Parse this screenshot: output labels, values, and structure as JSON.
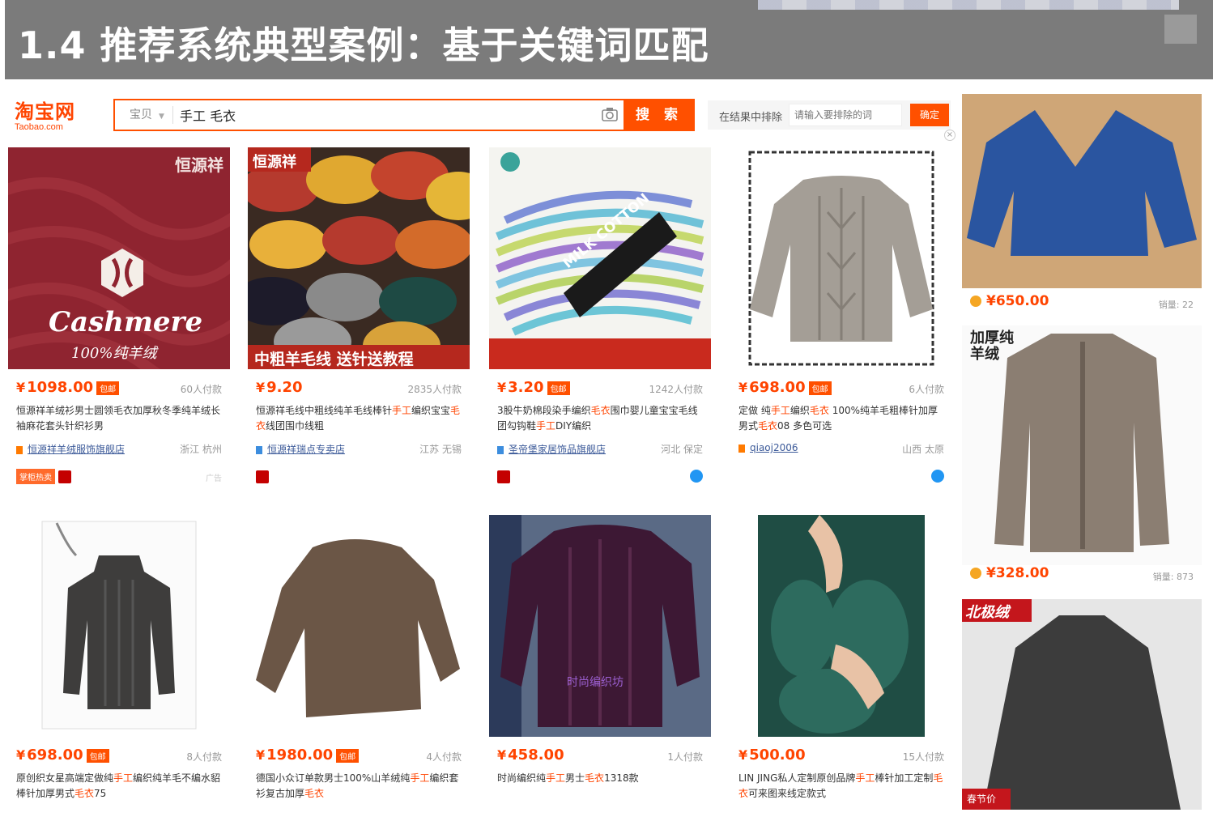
{
  "slide": {
    "title": "1.4 推荐系统典型案例：基于关键词匹配"
  },
  "header": {
    "logo_cn": "淘宝网",
    "logo_en": "Taobao.com",
    "scope": "宝贝",
    "query": "手工 毛衣",
    "search_button": "搜 索",
    "exclude_label": "在结果中排除",
    "exclude_placeholder": "请输入要排除的词",
    "exclude_button": "确定"
  },
  "colors": {
    "accent": "#ff5000",
    "price": "#ff4400",
    "shop_link": "#3c5a99"
  },
  "products": [
    {
      "price": "1098.00",
      "badge": "包邮",
      "sold": "60人付款",
      "desc_parts": [
        "恒源祥羊绒衫男士圆领毛衣加厚秋冬季纯羊绒长袖麻花套头针织衫男"
      ],
      "shop": "恒源祥羊绒服饰旗舰店",
      "location": "浙江 杭州",
      "img_brand": "恒源祥",
      "img_text": "Cashmere",
      "img_sub": "100%纯羊绒",
      "tag": "掌柜热卖",
      "ad": "广告"
    },
    {
      "price": "9.20",
      "badge": "",
      "sold": "2835人付款",
      "desc_parts": [
        "恒源祥毛线中粗线纯羊毛线棒针",
        "手工",
        "编织宝宝",
        "毛衣",
        "线团围巾线粗"
      ],
      "shop": "恒源祥瑞点专卖店",
      "location": "江苏 无锡",
      "img_brand": "恒源祥",
      "img_text": "中粗羊毛线 送针送教程"
    },
    {
      "price": "3.20",
      "badge": "包邮",
      "sold": "1242人付款",
      "desc_parts": [
        "3股牛奶棉段染手编织",
        "毛衣",
        "围巾婴儿童宝宝毛线团勾钩鞋",
        "手工",
        "DIY编织"
      ],
      "shop": "圣帝堡家居饰品旗舰店",
      "location": "河北 保定",
      "img_text": "MILK COTTON"
    },
    {
      "price": "698.00",
      "badge": "包邮",
      "sold": "6人付款",
      "desc_parts": [
        "定做 纯",
        "手工",
        "编织",
        "毛衣",
        " 100%纯羊毛粗棒针加厚男式",
        "毛衣",
        "08 多色可选"
      ],
      "shop": "qiaoj2006",
      "location": "山西 太原"
    },
    {
      "price": "698.00",
      "badge": "包邮",
      "sold": "8人付款",
      "desc_parts": [
        "原创织女星高端定做纯",
        "手工",
        "编织纯羊毛不编水貂棒针加厚男式",
        "毛衣",
        "75"
      ]
    },
    {
      "price": "1980.00",
      "badge": "包邮",
      "sold": "4人付款",
      "desc_parts": [
        "德国小众订单款男士100%山羊绒纯",
        "手工",
        "编织套衫复古加厚",
        "毛衣"
      ]
    },
    {
      "price": "458.00",
      "badge": "",
      "sold": "1人付款",
      "desc_parts": [
        "时尚编织纯",
        "手工",
        "男士",
        "毛衣",
        "1318款"
      ],
      "img_text": "时尚编织坊"
    },
    {
      "price": "500.00",
      "badge": "",
      "sold": "15人付款",
      "desc_parts": [
        "LIN JING私人定制原创品牌",
        "手工",
        "棒针加工定制",
        "毛衣",
        "可来图来线定款式"
      ]
    }
  ],
  "side": [
    {
      "price": "¥650.00",
      "sales": "销量: 22"
    },
    {
      "price": "¥328.00",
      "sales": "销量: 873",
      "img_label": "加厚纯羊绒"
    },
    {
      "img_label": "北极绒",
      "img_sub": "春节价"
    }
  ]
}
